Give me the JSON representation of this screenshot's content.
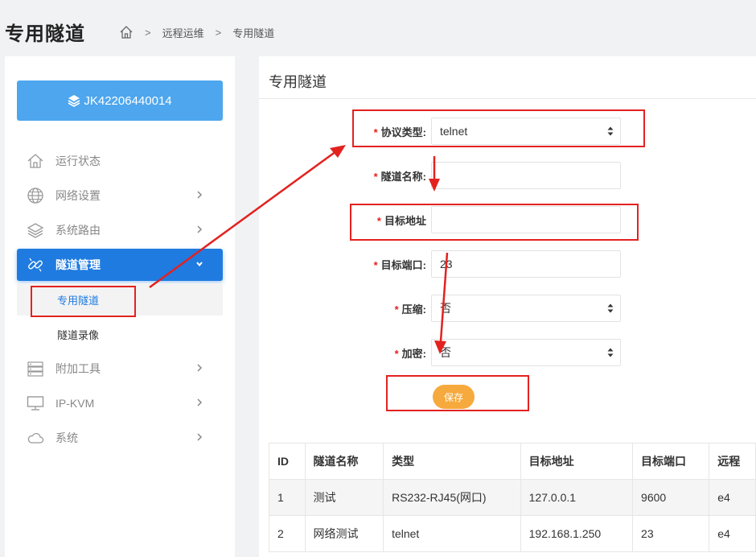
{
  "header": {
    "title": "专用隧道",
    "breadcrumb": [
      "远程运维",
      "专用隧道"
    ]
  },
  "sidebar": {
    "device": "JK42206440014",
    "items": [
      {
        "label": "运行状态",
        "icon": "house-icon"
      },
      {
        "label": "网络设置",
        "icon": "globe-icon"
      },
      {
        "label": "系统路由",
        "icon": "layers-icon"
      },
      {
        "label": "隧道管理",
        "icon": "link-icon"
      },
      {
        "label": "附加工具",
        "icon": "server-icon"
      },
      {
        "label": "IP-KVM",
        "icon": "monitor-icon"
      },
      {
        "label": "系统",
        "icon": "cloud-icon"
      }
    ],
    "subitems": [
      "专用隧道",
      "隧道录像"
    ]
  },
  "panel": {
    "title": "专用隧道"
  },
  "form": {
    "protocol_label": "协议类型:",
    "protocol_value": "telnet",
    "name_label": "隧道名称:",
    "name_value": "",
    "target_label": "目标地址",
    "target_value": "",
    "port_label": "目标端口:",
    "port_value": "23",
    "compress_label": "压缩:",
    "compress_value": "否",
    "encrypt_label": "加密:",
    "encrypt_value": "否",
    "save_label": "保存"
  },
  "table": {
    "headers": [
      "ID",
      "隧道名称",
      "类型",
      "目标地址",
      "目标端口",
      "远程"
    ],
    "rows": [
      [
        "1",
        "测试",
        "RS232-RJ45(网口)",
        "127.0.0.1",
        "9600",
        "e4"
      ],
      [
        "2",
        "网络测试",
        "telnet",
        "192.168.1.250",
        "23",
        "e4"
      ]
    ]
  },
  "colors": {
    "accent": "#1f7be0",
    "device_button": "#4da6ee",
    "save_button": "#f6a93c",
    "annotation_red": "#e3221f",
    "required_star": "#e3221f"
  }
}
